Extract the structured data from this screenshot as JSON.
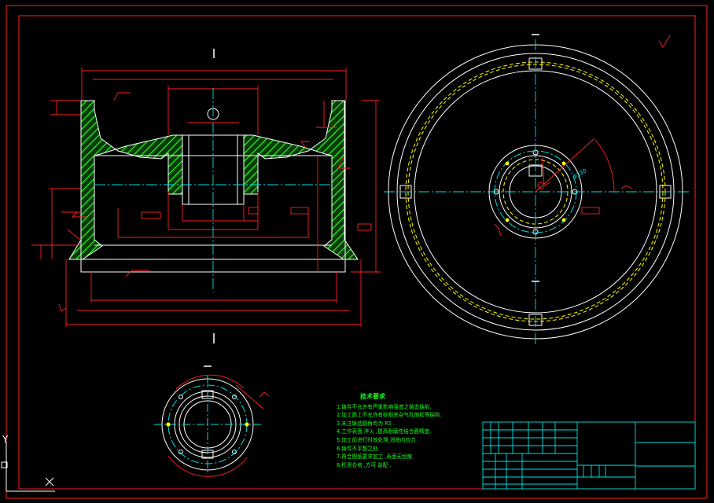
{
  "drawing": {
    "dimension_label": "Φ330",
    "ucs_axis_label": "Y"
  },
  "notes": {
    "title": "技术要求",
    "lines": [
      "1.铸件不允许有严重影响强度之铸造缺陷.",
      "2.加工面上不允许有砂眼夹杂气孔缩松等缺陷.",
      "3.未注铸造圆角均为 R5 .",
      "4.工作表面 淬火 ,提高耐磨性结合面精度.",
      "5.加工前进行时效处理,消除内应力 .",
      "6.铸件不平整之处.",
      "7.符合图纸要求加工 ,表面无划痕.",
      "8.检测合格 ,方可 装配 ."
    ]
  },
  "colors": {
    "frame": "#ff2020",
    "outline": "#ffffff",
    "dimension": "#ff2020",
    "centerline": "#00e0e0",
    "hatch": "#20ff20",
    "hidden": "#ffff00",
    "title_block": "#00e0e0",
    "text": "#18ff18"
  }
}
